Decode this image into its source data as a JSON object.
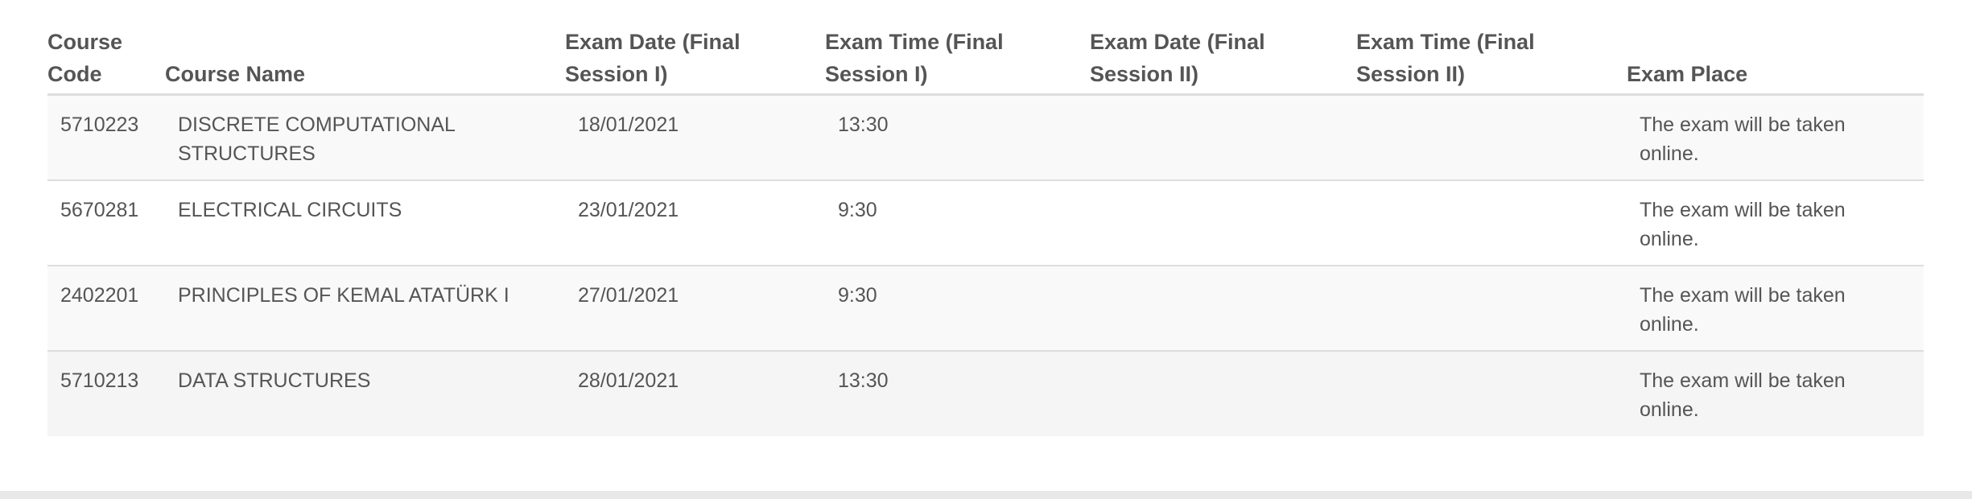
{
  "table": {
    "headers": [
      "Course Code",
      "Course Name",
      "Exam Date (Final Session I)",
      "Exam Time (Final Session I)",
      "Exam Date (Final Session II)",
      "Exam Time (Final Session II)",
      "Exam Place"
    ],
    "rows": [
      [
        "5710223",
        "DISCRETE COMPUTATIONAL STRUCTURES",
        "18/01/2021",
        "13:30",
        "",
        "",
        "The exam will be taken online."
      ],
      [
        "5670281",
        "ELECTRICAL CIRCUITS",
        "23/01/2021",
        "9:30",
        "",
        "",
        "The exam will be taken online."
      ],
      [
        "2402201",
        "PRINCIPLES OF KEMAL ATATÜRK I",
        "27/01/2021",
        "9:30",
        "",
        "",
        "The exam will be taken online."
      ],
      [
        "5710213",
        "DATA STRUCTURES",
        "28/01/2021",
        "13:30",
        "",
        "",
        "The exam will be taken online."
      ]
    ]
  },
  "colors": {
    "header_text": "#555555",
    "row_alt_bg": "#f9f9f9",
    "border": "#dddddd"
  }
}
